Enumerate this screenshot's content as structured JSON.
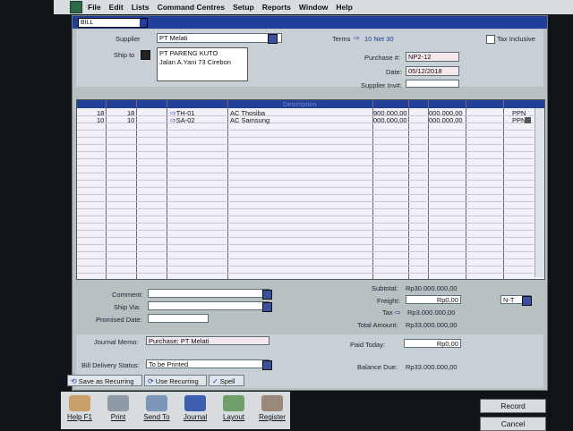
{
  "menu": [
    "File",
    "Edit",
    "Lists",
    "Command Centres",
    "Setup",
    "Reports",
    "Window",
    "Help"
  ],
  "window": {
    "type_select": "BILL"
  },
  "header": {
    "supplier_label": "Supplier",
    "supplier_value": "PT Melati",
    "terms_label": "Terms",
    "terms_value": "10 Net 30",
    "tax_inclusive_label": "Tax Inclusive",
    "ship_to_label": "Ship to",
    "ship_to_lines": [
      "PT PARENG KUTO",
      "Jalan A.Yani 73 Cirebon"
    ],
    "purchase_label": "Purchase #:",
    "purchase_value": "NP2-12",
    "date_label": "Date:",
    "date_value": "05/12/2018",
    "supplier_inv_label": "Supplier Inv#:",
    "supplier_inv_value": ""
  },
  "grid": {
    "headers": [
      "Description"
    ],
    "rows": [
      {
        "ordered": "18",
        "received": "18",
        "item": "TH-01",
        "name": "AC Thosiba",
        "price": "900.000,00",
        "total": "000.000,00",
        "tax": "PPN"
      },
      {
        "ordered": "10",
        "received": "10",
        "item": "SA-02",
        "name": "AC Samsung",
        "price": "000.000,00",
        "total": "000.000,00",
        "tax": "PPN"
      }
    ]
  },
  "footer": {
    "comment_label": "Comment:",
    "ship_via_label": "Ship Via:",
    "promised_label": "Promised Date:",
    "subtotal_label": "Subtotal:",
    "subtotal_value": "Rp30.000.000,00",
    "freight_label": "Freight:",
    "freight_value": "Rp0,00",
    "freight_tax": "N-T",
    "tax_label": "Tax",
    "tax_value": "Rp3.000.000,00",
    "total_label": "Total Amount:",
    "total_value": "Rp33.000.000,00",
    "journal_label": "Journal Memo:",
    "journal_value": "Purchase; PT Melati",
    "paid_label": "Paid Today:",
    "paid_value": "Rp0,00",
    "delivery_label": "Bill Delivery Status:",
    "delivery_value": "To be Printed",
    "balance_label": "Balance Due:",
    "balance_value": "Rp33.000.000,00",
    "save_recurring": "Save as Recurring",
    "use_recurring": "Use Recurring",
    "spell": "Spell"
  },
  "toolbar": [
    "Help F1",
    "Print",
    "Send To",
    "Journal",
    "Layout",
    "Register"
  ],
  "right_buttons": [
    "Record",
    "Cancel"
  ]
}
